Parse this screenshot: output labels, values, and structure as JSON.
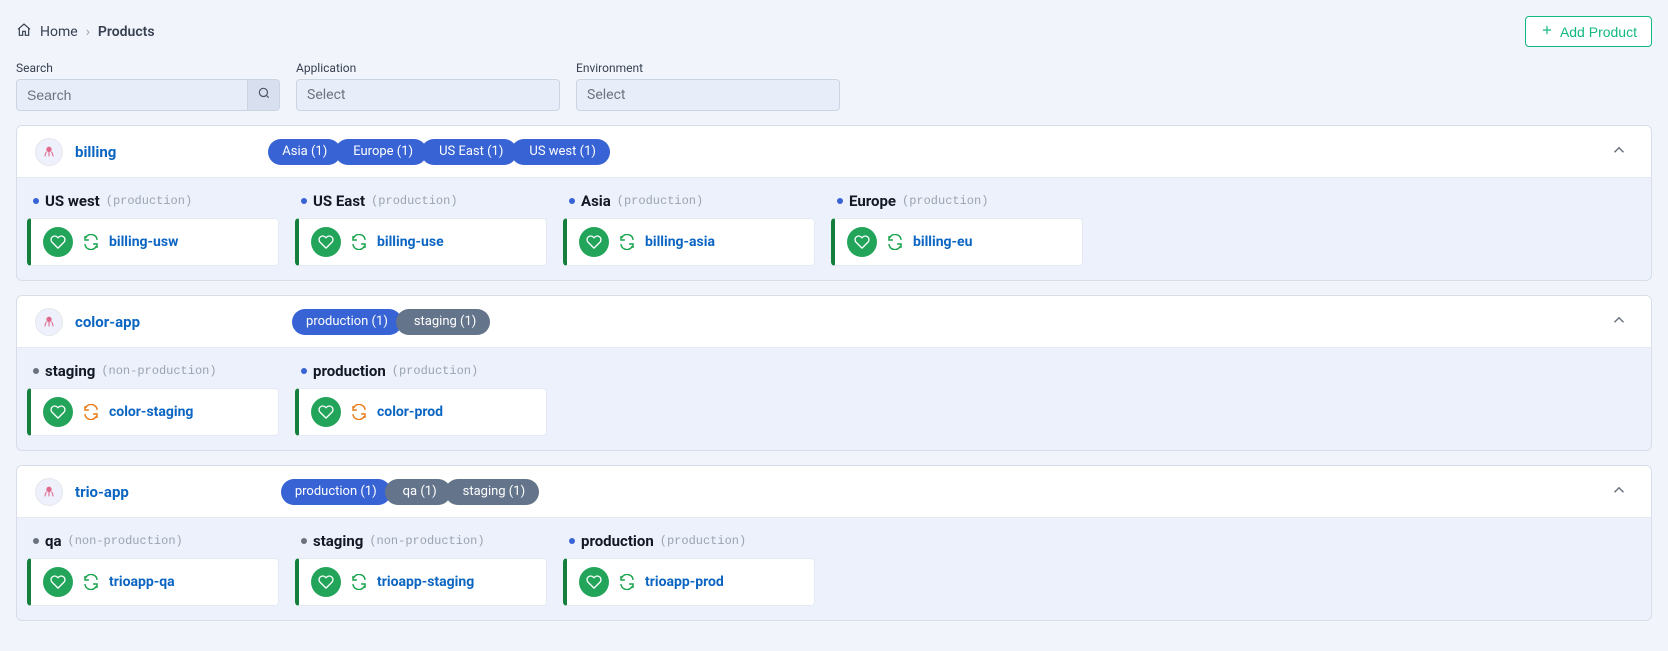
{
  "breadcrumb": {
    "home": "Home",
    "current": "Products"
  },
  "actions": {
    "addProduct": "Add Product"
  },
  "filters": {
    "searchLabel": "Search",
    "searchPlaceholder": "Search",
    "appLabel": "Application",
    "appPlaceholder": "Select",
    "envLabel": "Environment",
    "envPlaceholder": "Select"
  },
  "groups": [
    {
      "name": "billing",
      "chips": [
        {
          "label": "Asia (1)",
          "tone": "blue"
        },
        {
          "label": "Europe (1)",
          "tone": "blue"
        },
        {
          "label": "US East (1)",
          "tone": "blue"
        },
        {
          "label": "US west (1)",
          "tone": "blue"
        }
      ],
      "envs": [
        {
          "name": "US west",
          "type": "(production)",
          "dot": "blue",
          "app": "billing-usw",
          "sync": "green"
        },
        {
          "name": "US East",
          "type": "(production)",
          "dot": "blue",
          "app": "billing-use",
          "sync": "green"
        },
        {
          "name": "Asia",
          "type": "(production)",
          "dot": "blue",
          "app": "billing-asia",
          "sync": "green"
        },
        {
          "name": "Europe",
          "type": "(production)",
          "dot": "blue",
          "app": "billing-eu",
          "sync": "green"
        }
      ]
    },
    {
      "name": "color-app",
      "chips": [
        {
          "label": "production (1)",
          "tone": "blue"
        },
        {
          "label": "staging (1)",
          "tone": "grey"
        }
      ],
      "envs": [
        {
          "name": "staging",
          "type": "(non-production)",
          "dot": "grey",
          "app": "color-staging",
          "sync": "orange"
        },
        {
          "name": "production",
          "type": "(production)",
          "dot": "blue",
          "app": "color-prod",
          "sync": "orange"
        }
      ]
    },
    {
      "name": "trio-app",
      "chips": [
        {
          "label": "production (1)",
          "tone": "blue"
        },
        {
          "label": "qa (1)",
          "tone": "grey"
        },
        {
          "label": "staging (1)",
          "tone": "grey"
        }
      ],
      "envs": [
        {
          "name": "qa",
          "type": "(non-production)",
          "dot": "grey",
          "app": "trioapp-qa",
          "sync": "green"
        },
        {
          "name": "staging",
          "type": "(non-production)",
          "dot": "grey",
          "app": "trioapp-staging",
          "sync": "green"
        },
        {
          "name": "production",
          "type": "(production)",
          "dot": "blue",
          "app": "trioapp-prod",
          "sync": "green"
        }
      ]
    }
  ]
}
